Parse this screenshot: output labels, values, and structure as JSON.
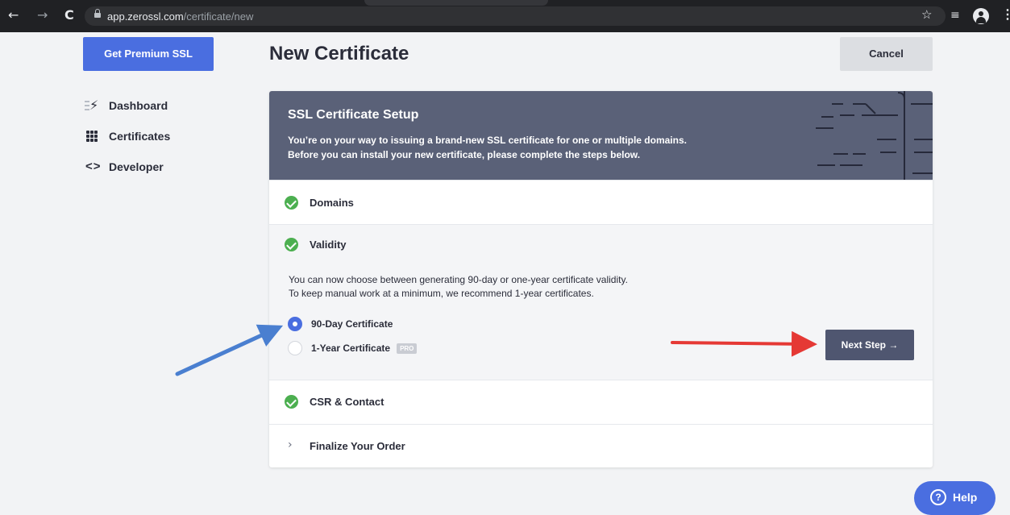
{
  "browser": {
    "back_glyph": "←",
    "forward_glyph": "→",
    "reload_glyph": "C",
    "url_host": "app.zerossl.com",
    "url_path": "/certificate/new",
    "star_glyph": "☆",
    "queue_glyph": "≡",
    "menu_glyph": "⋮"
  },
  "sidebar": {
    "premium_label": "Get Premium SSL",
    "items": [
      {
        "label": "Dashboard",
        "icon": "bolt-icon"
      },
      {
        "label": "Certificates",
        "icon": "grid-icon"
      },
      {
        "label": "Developer",
        "icon": "code-icon",
        "glyph": "<>"
      }
    ]
  },
  "header": {
    "title": "New Certificate",
    "cancel_label": "Cancel"
  },
  "setup": {
    "title": "SSL Certificate Setup",
    "desc_line1": "You’re on your way to issuing a brand-new SSL certificate for one or multiple domains.",
    "desc_line2": "Before you can install your new certificate, please complete the steps below."
  },
  "steps": {
    "domains": "Domains",
    "validity": "Validity",
    "validity_text_line1": "You can now choose between generating 90-day or one-year certificate validity.",
    "validity_text_line2": "To keep manual work at a minimum, we recommend 1-year certificates.",
    "option_90": "90-Day Certificate",
    "option_1y": "1-Year Certificate",
    "pro_badge": "PRO",
    "selected_option": "90-Day Certificate",
    "next_label": "Next Step →",
    "csr": "CSR & Contact",
    "finalize": "Finalize Your Order",
    "finalize_chevron": "›"
  },
  "help": {
    "icon_glyph": "?",
    "label": "Help"
  },
  "colors": {
    "brand_blue": "#4a6ee0",
    "header_slate": "#5a6178",
    "success_green": "#4caf50",
    "annotation_red": "#e53935",
    "annotation_blue": "#4a7fd0"
  }
}
